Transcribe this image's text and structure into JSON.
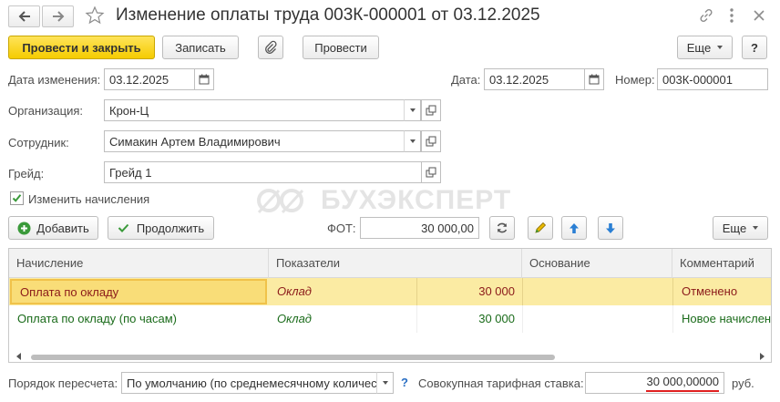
{
  "window": {
    "title": "Изменение оплаты труда 003К-000001 от 03.12.2025"
  },
  "toolbar": {
    "post_and_close": "Провести и закрыть",
    "save": "Записать",
    "post": "Провести",
    "more": "Еще",
    "help": "?"
  },
  "form": {
    "change_date_label": "Дата изменения:",
    "change_date_value": "03.12.2025",
    "date_label": "Дата:",
    "date_value": "03.12.2025",
    "number_label": "Номер:",
    "number_value": "003К-000001",
    "org_label": "Организация:",
    "org_value": "Крон-Ц",
    "employee_label": "Сотрудник:",
    "employee_value": "Симакин Артем Владимирович",
    "grade_label": "Грейд:",
    "grade_value": "Грейд 1",
    "change_accruals_label": "Изменить начисления",
    "change_accruals_checked": true
  },
  "watermark": "БУХЭКСПЕРТ",
  "table_toolbar": {
    "add": "Добавить",
    "continue": "Продолжить",
    "fot_label": "ФОТ:",
    "fot_value": "30 000,00",
    "more": "Еще"
  },
  "table": {
    "columns": [
      "Начисление",
      "Показатели",
      "Основание",
      "Комментарий"
    ],
    "rows": [
      {
        "accrual": "Оплата по окладу",
        "indicator": "Оклад",
        "value": "30 000",
        "basis": "",
        "comment": "Отменено",
        "color": "#8b1a1a",
        "selected": true
      },
      {
        "accrual": "Оплата по окладу (по часам)",
        "indicator": "Оклад",
        "value": "30 000",
        "basis": "",
        "comment": "Новое начисление",
        "color": "#1a6b1a",
        "selected": false
      }
    ]
  },
  "footer": {
    "recalc_label": "Порядок пересчета:",
    "recalc_value": "По умолчанию (по среднемесячному количеству",
    "help": "?",
    "rate_label": "Совокупная тарифная ставка:",
    "rate_value": "30 000,00000",
    "rate_unit": "руб."
  },
  "colors": {
    "primary_button": "#f5cc00",
    "cancelled_row_text": "#8b1a1a",
    "new_row_text": "#1a6b1a",
    "selected_row_bg": "#fbeba3",
    "underline_red": "#e02020",
    "arrow_blue": "#2a7fd4",
    "add_green": "#3a9a3a"
  }
}
